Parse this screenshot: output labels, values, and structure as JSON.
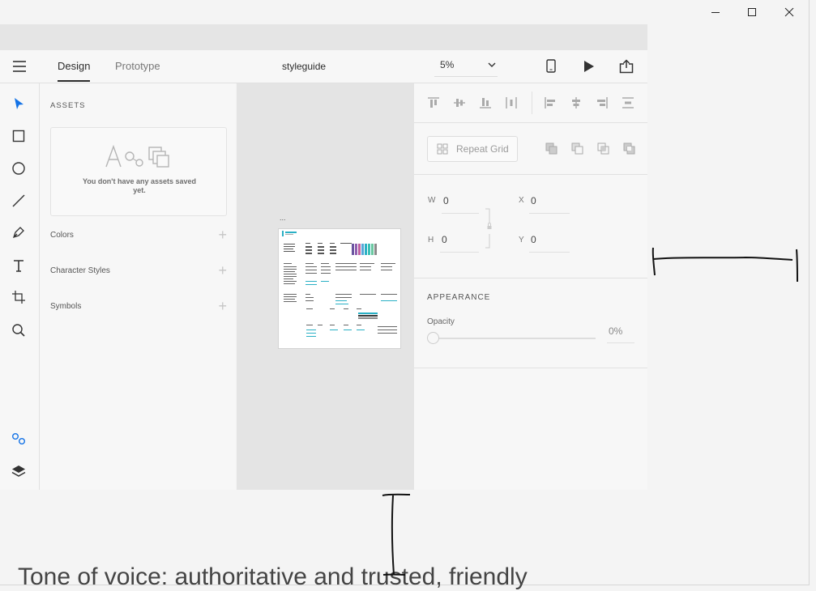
{
  "header": {
    "tabs": [
      {
        "label": "Design"
      },
      {
        "label": "Prototype"
      }
    ],
    "document_title": "styleguide",
    "zoom_value": "5%"
  },
  "assets": {
    "title": "ASSETS",
    "empty_message": "You don't have any assets saved yet.",
    "sections": [
      {
        "label": "Colors"
      },
      {
        "label": "Character Styles"
      },
      {
        "label": "Symbols"
      }
    ]
  },
  "inspector": {
    "repeat_grid_label": "Repeat Grid",
    "fields": {
      "w": {
        "label": "W",
        "value": "0"
      },
      "h": {
        "label": "H",
        "value": "0"
      },
      "x": {
        "label": "X",
        "value": "0"
      },
      "y": {
        "label": "Y",
        "value": "0"
      }
    },
    "appearance_title": "APPEARANCE",
    "opacity_label": "Opacity",
    "opacity_value": "0%"
  },
  "canvas": {
    "artboard_label": "..."
  },
  "background_text": "Tone of voice: authoritative and trusted, friendly",
  "colors": {
    "accent": "#1473e6",
    "artboard_teal": "#2ab0c5"
  }
}
